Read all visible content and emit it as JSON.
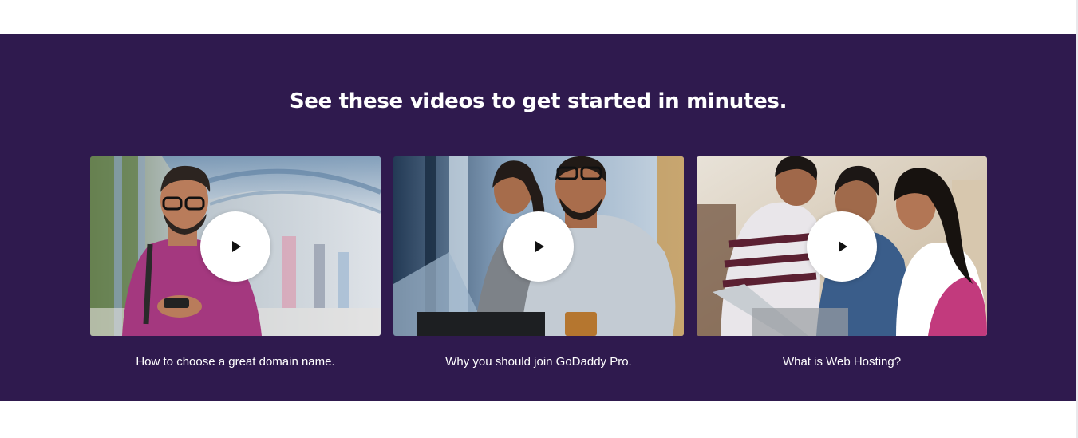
{
  "section": {
    "heading": "See these videos to get started in minutes.",
    "background_color": "#2f1a4e"
  },
  "videos": [
    {
      "caption": "How to choose a great domain name.",
      "thumbnail": "man-with-glasses-using-phone-in-walkway",
      "play_icon": "play-icon"
    },
    {
      "caption": "Why you should join GoDaddy Pro.",
      "thumbnail": "two-people-laughing-at-computer",
      "play_icon": "play-icon"
    },
    {
      "caption": "What is Web Hosting?",
      "thumbnail": "three-friends-looking-at-laptop",
      "play_icon": "play-icon"
    }
  ]
}
